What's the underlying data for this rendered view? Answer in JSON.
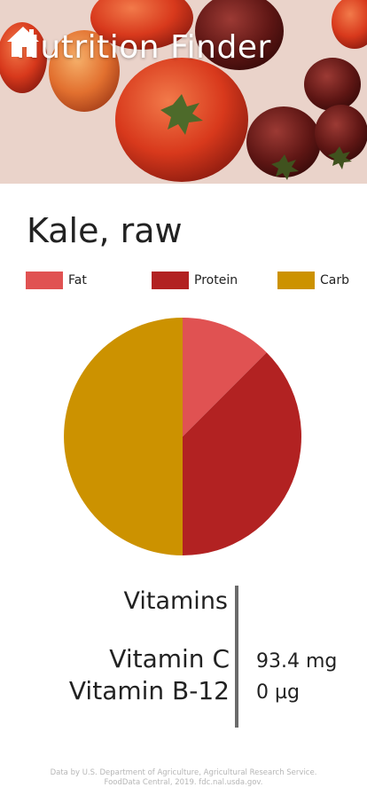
{
  "header": {
    "title": "Nutrition Finder",
    "home_icon": "home-icon"
  },
  "food": {
    "name": "Kale, raw"
  },
  "chart_data": {
    "type": "pie",
    "series": [
      {
        "name": "Fat",
        "value": 12.5,
        "color": "#e05252"
      },
      {
        "name": "Protein",
        "value": 37.5,
        "color": "#b22222"
      },
      {
        "name": "Carb",
        "value": 50.0,
        "color": "#cc9200"
      }
    ],
    "legend": "top"
  },
  "vitamins": {
    "heading": "Vitamins",
    "items": [
      {
        "name": "Vitamin C",
        "value": "93.4 mg"
      },
      {
        "name": "Vitamin B-12",
        "value": "0 µg"
      }
    ]
  },
  "footer": {
    "line1": "Data by U.S. Department of Agriculture, Agricultural Research Service.",
    "line2": "FoodData Central, 2019. fdc.nal.usda.gov."
  }
}
